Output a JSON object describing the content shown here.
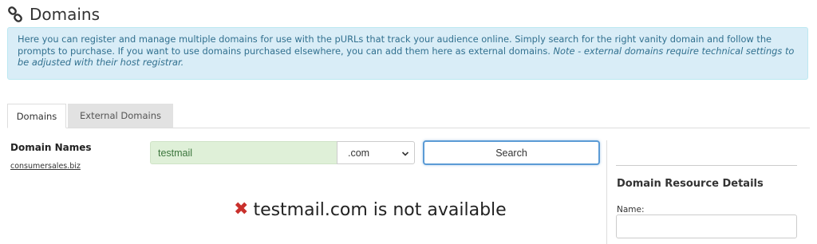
{
  "page": {
    "title": "Domains",
    "title_icon": "link-icon"
  },
  "info": {
    "text": "Here you can register and manage multiple domains for use with the pURLs that track your audience online. Simply search for the right vanity domain and follow the prompts to purchase. If you want to use domains purchased elsewhere, you can add them here as external domains.",
    "note": "Note - external domains require technical settings to be adjusted with their host registrar."
  },
  "tabs": [
    {
      "label": "Domains",
      "active": true
    },
    {
      "label": "External Domains",
      "active": false
    }
  ],
  "sidebar": {
    "title": "Domain Names",
    "items": [
      "consumersales.biz"
    ]
  },
  "search": {
    "value": "testmail",
    "tld": ".com",
    "button_label": "Search"
  },
  "result": {
    "icon": "x-mark-icon",
    "message": "testmail.com is not available",
    "status_color": "#c9302c"
  },
  "details": {
    "title": "Domain Resource Details",
    "name_label": "Name:",
    "name_value": ""
  }
}
